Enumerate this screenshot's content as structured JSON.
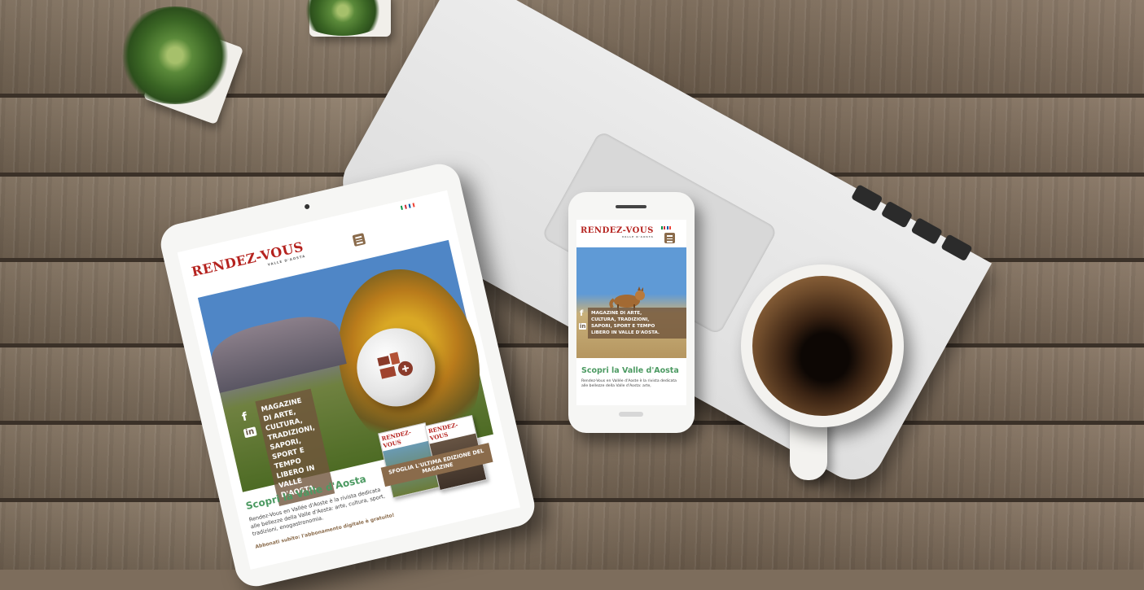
{
  "site": {
    "logo": "RENDEZ-VOUS",
    "logo_sub": "VALLE D'AOSTA",
    "tagline_tablet": [
      "MAGAZINE",
      "DI ARTE,",
      "CULTURA,",
      "TRADIZIONI,",
      "SAPORI,",
      "SPORT E",
      "TEMPO",
      "LIBERO IN",
      "VALLE",
      "D'AOSTA."
    ],
    "tagline_phone": [
      "MAGAZINE DI ARTE,",
      "CULTURA, TRADIZIONI,",
      "SAPORI, SPORT E TEMPO",
      "LIBERO IN VALLE D'AOSTA."
    ],
    "social": {
      "facebook": "f",
      "linkedin": "in"
    },
    "intro_title": "Scopri la Valle d'Aosta",
    "intro_text_tablet": "Rendez-Vous en Vallée d'Aoste è la rivista dedicata alle bellezze della Valle d'Aosta: arte, cultura, sport, tradizioni, enogastronomia.",
    "intro_text_phone": "Rendez-Vous en Vallée d'Aoste è la rivista dedicata alle bellezze della Valle d'Aosta: arte,",
    "subscribe_link": "Abbonati subito: l'abbonamento digitale è gratuito!",
    "magazine_banner": "SFOGLIA L'ULTIMA EDIZIONE DEL MAGAZINE",
    "magazine_cover_title": "RENDEZ-VOUS"
  },
  "icons": {
    "menu": "hamburger-menu-icon",
    "flag_it": "italian-flag-icon",
    "flag_fr": "french-flag-icon",
    "facebook": "facebook-icon",
    "linkedin": "linkedin-icon"
  },
  "colors": {
    "brand_red": "#b5231f",
    "accent_brown": "#8a6b4b",
    "title_green": "#4c9a62"
  }
}
